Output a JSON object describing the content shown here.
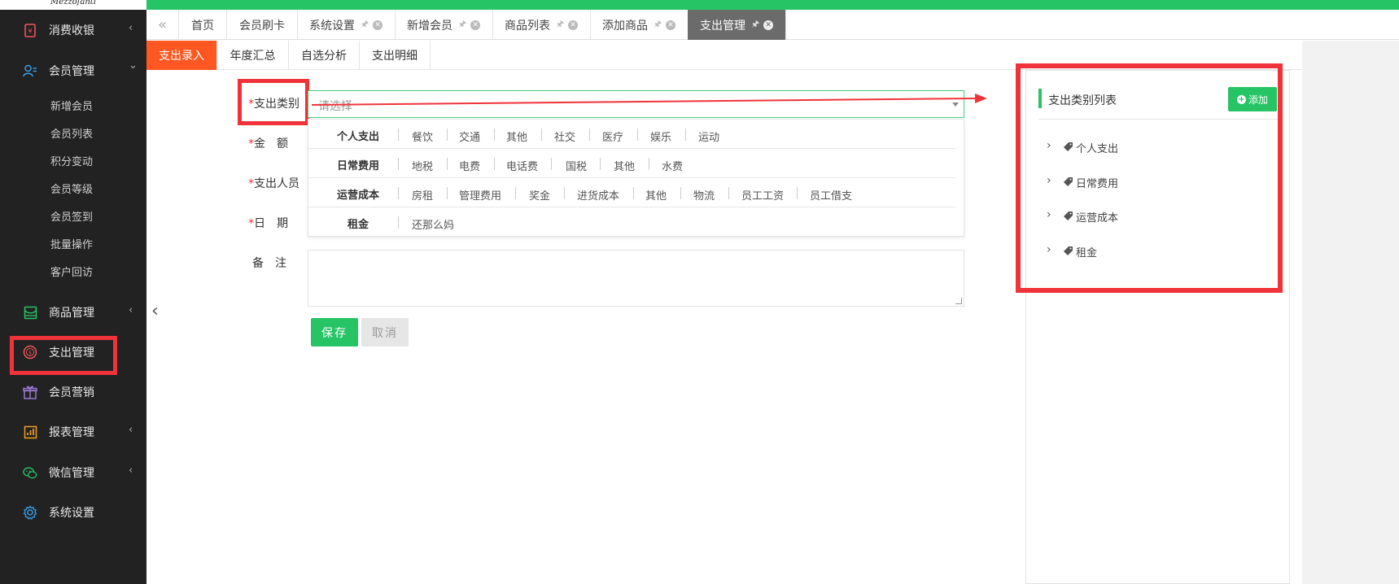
{
  "logo_text": "Mezzofanti",
  "sidebar": {
    "items": [
      {
        "label": "消费收银",
        "icon": "cashier-icon",
        "has_arrow": true
      },
      {
        "label": "会员管理",
        "icon": "member-icon",
        "expanded": true
      },
      {
        "label": "商品管理",
        "icon": "goods-icon",
        "has_arrow": true
      },
      {
        "label": "支出管理",
        "icon": "expense-icon"
      },
      {
        "label": "会员营销",
        "icon": "gift-icon"
      },
      {
        "label": "报表管理",
        "icon": "report-icon",
        "has_arrow": true
      },
      {
        "label": "微信管理",
        "icon": "wechat-icon",
        "has_arrow": true
      },
      {
        "label": "系统设置",
        "icon": "gear-icon"
      }
    ],
    "submenu": [
      "新增会员",
      "会员列表",
      "积分变动",
      "会员等级",
      "会员签到",
      "批量操作",
      "客户回访"
    ],
    "arrow_left": "‹",
    "arrow_down": "⌄"
  },
  "tabs": [
    {
      "label": "首页"
    },
    {
      "label": "会员刷卡"
    },
    {
      "label": "系统设置"
    },
    {
      "label": "新增会员"
    },
    {
      "label": "商品列表"
    },
    {
      "label": "添加商品"
    },
    {
      "label": "支出管理",
      "active": true
    }
  ],
  "subtabs": [
    "支出录入",
    "年度汇总",
    "自选分析",
    "支出明细"
  ],
  "form": {
    "category_label": "支出类别",
    "amount_label": "金　额",
    "person_label": "支出人员",
    "date_label": "日　期",
    "remark_label": "备　注",
    "select_placeholder": "请选择",
    "save": "保存",
    "cancel": "取消"
  },
  "dropdown": [
    {
      "title": "个人支出",
      "options": [
        "餐饮",
        "交通",
        "其他",
        "社交",
        "医疗",
        "娱乐",
        "运动"
      ]
    },
    {
      "title": "日常费用",
      "options": [
        "地税",
        "电费",
        "电话费",
        "国税",
        "其他",
        "水费"
      ]
    },
    {
      "title": "运营成本",
      "options": [
        "房租",
        "管理费用",
        "奖金",
        "进货成本",
        "其他",
        "物流",
        "员工工资",
        "员工借支"
      ]
    },
    {
      "title": "租金",
      "options": [
        "还那么妈"
      ]
    }
  ],
  "panel": {
    "title": "支出类别列表",
    "add_label": "添加",
    "tree": [
      "个人支出",
      "日常费用",
      "运营成本",
      "租金"
    ]
  },
  "colors": {
    "accent": "#27c466",
    "active_subtab": "#ff5722",
    "highlight": "#f0333a",
    "sidebar": "#222222"
  }
}
